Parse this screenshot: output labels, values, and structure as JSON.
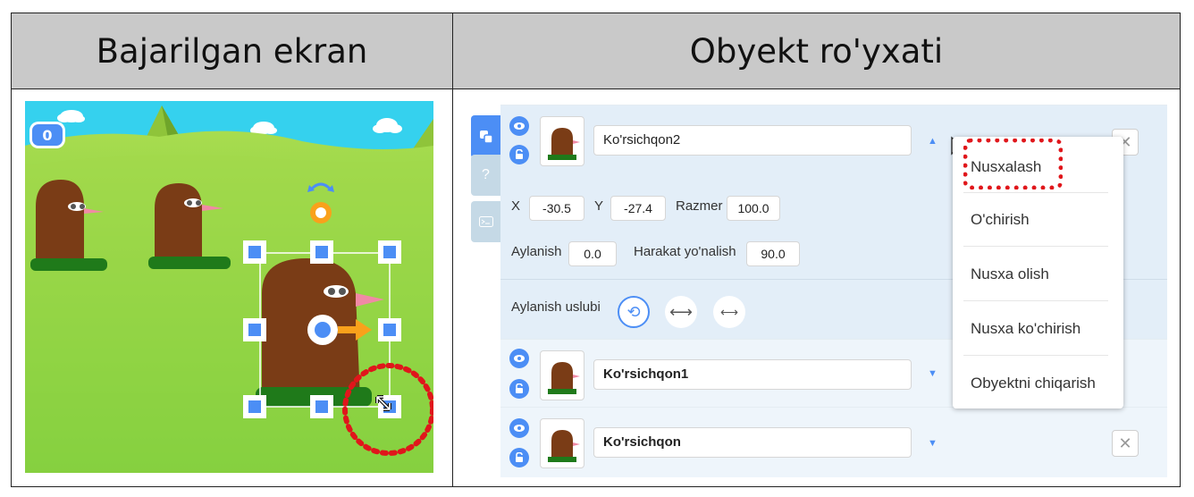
{
  "table": {
    "left_header": "Bajarilgan ekran",
    "right_header": "Obyekt ro'yxati"
  },
  "stage": {
    "counter": "0"
  },
  "panel": {
    "help_tab": "?",
    "objects": [
      {
        "name": "Ko'rsichqon2",
        "selected": true
      },
      {
        "name": "Ko'rsichqon1",
        "selected": false
      },
      {
        "name": "Ko'rsichqon",
        "selected": false
      }
    ],
    "props": {
      "x_label": "X",
      "x_value": "-30.5",
      "y_label": "Y",
      "y_value": "-27.4",
      "size_label": "Razmer",
      "size_value": "100.0",
      "rotation_label": "Aylanish",
      "rotation_value": "0.0",
      "direction_label": "Harakat yo'nalish",
      "direction_value": "90.0",
      "rotation_style_label": "Aylanish uslubi"
    },
    "close_symbol": "✕"
  },
  "context_menu": {
    "items": [
      "Nusxalash",
      "O'chirish",
      "Nusxa olish",
      "Nusxa ko'chirish",
      "Obyektni chiqarish"
    ]
  },
  "colors": {
    "accent": "#4c8ef5",
    "highlight": "#e0161b",
    "header_bg": "#c9c9c9",
    "sky": "#35d1ee",
    "grass": "#8fd14a",
    "mole": "#7a3c16"
  }
}
